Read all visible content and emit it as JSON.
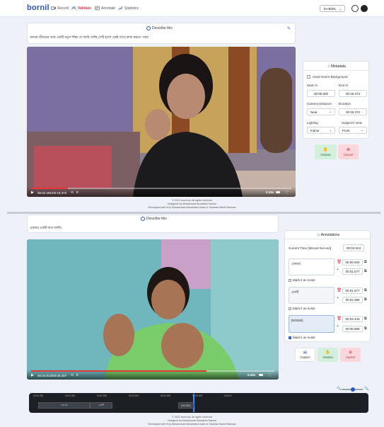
{
  "nav": {
    "logo": "bornil",
    "items": [
      {
        "label": "Record",
        "icon": "video-camera-icon"
      },
      {
        "label": "Validate",
        "icon": "hands-icon",
        "active": true
      },
      {
        "label": "Annotate",
        "icon": "annotate-icon"
      },
      {
        "label": "Statistics",
        "icon": "chart-line-icon"
      }
    ],
    "language": "bn-BdSL"
  },
  "validate": {
    "describe_title": "Describe this",
    "description": "আমার জীবনের আর একটি নতুন শিক্ষা যে আমি পাচ্ছি সেটি হলো একই সাথে কাজ করতে পারব",
    "video_time": "00:02.491/00:18.372",
    "speed": "0.25x",
    "progress": 0.14,
    "metadata": {
      "title": "Metadata",
      "green_bg_label": "Used Green Background",
      "start_label": "Start At",
      "start_value": "00:00.000",
      "end_label": "End At",
      "end_value": "00:18.372",
      "distance_label": "Camera Distance",
      "distance_value": "Near",
      "duration_label": "Duration",
      "duration_value": "00:18.372",
      "lighting_label": "Lighting",
      "lighting_value": "Indoor",
      "view_label": "Subject's View",
      "view_value": "Front"
    },
    "validate_label": "Validate",
    "cancel_label": "Cancel"
  },
  "footer": {
    "line1": "© 2022 bornil.ai | All rights reserved",
    "line2": "Designed by Muhammad Muntakim Sarwar",
    "line3": "Developed with ♥ by Mohammad Mohaiminul Islam & Shahriar Sakib Rahman"
  },
  "annotate": {
    "describe_title": "Describe this",
    "description": "একবার একটি কথা বলছি।",
    "video_time": "00:04.913/00:06.387",
    "speed": "0.25x",
    "progress": 0.72,
    "annotations": {
      "title": "Annotations",
      "current_time_label": "Current Time (Minute:Second)",
      "current_time_value": "00:04.913",
      "noise_label": "Mark it as noise",
      "items": [
        {
          "text": "একবার",
          "start": "00:00.000",
          "end": "00:01.577",
          "noise": false
        },
        {
          "text": "একটি",
          "start": "00:01.577",
          "end": "00:02.386",
          "noise": false
        },
        {
          "text": "[NOISE]",
          "start": "00:04.443",
          "end": "00:06.868",
          "noise": true
        }
      ]
    },
    "caption_label": "Caption",
    "validate_label": "Validate",
    "cancel_label": "Cancel"
  },
  "timeline": {
    "ticks": [
      "00:00.000",
      "00:01.000",
      "00:02.000",
      "00:03.000",
      "00:04.000",
      "00:05.000",
      "00:06.0"
    ],
    "segments": [
      {
        "label": "একবার"
      },
      {
        "label": "একটি"
      },
      {
        "label": "[NOISE]"
      }
    ]
  },
  "colors": {
    "brand": "#2b55c8",
    "danger": "#e0354a",
    "success_bg": "#d3f0dc",
    "danger_bg": "#fbd6db"
  }
}
